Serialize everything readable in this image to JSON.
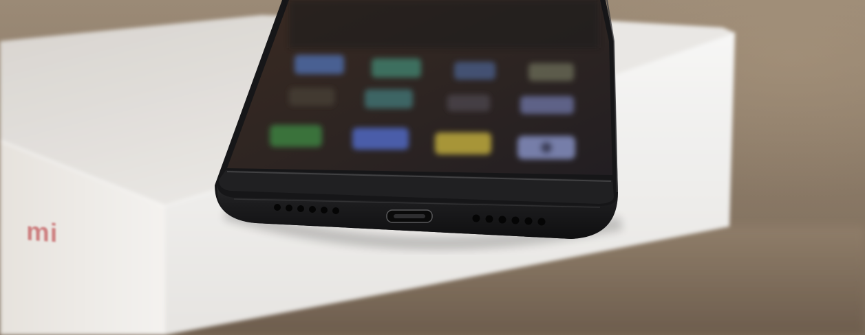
{
  "scene": {
    "description_tags": [
      "smartphone-bottom-edge",
      "product-box",
      "wooden-table"
    ],
    "box_logo_text": "mi",
    "colors": {
      "phone_body": "#1b1b1d",
      "box_white": "#efeeec",
      "box_logo": "#c2575a",
      "table": "#8c7b68"
    },
    "phone_features": {
      "left_speaker_holes": 6,
      "right_speaker_holes": 6,
      "port": "micro-usb-port"
    }
  }
}
